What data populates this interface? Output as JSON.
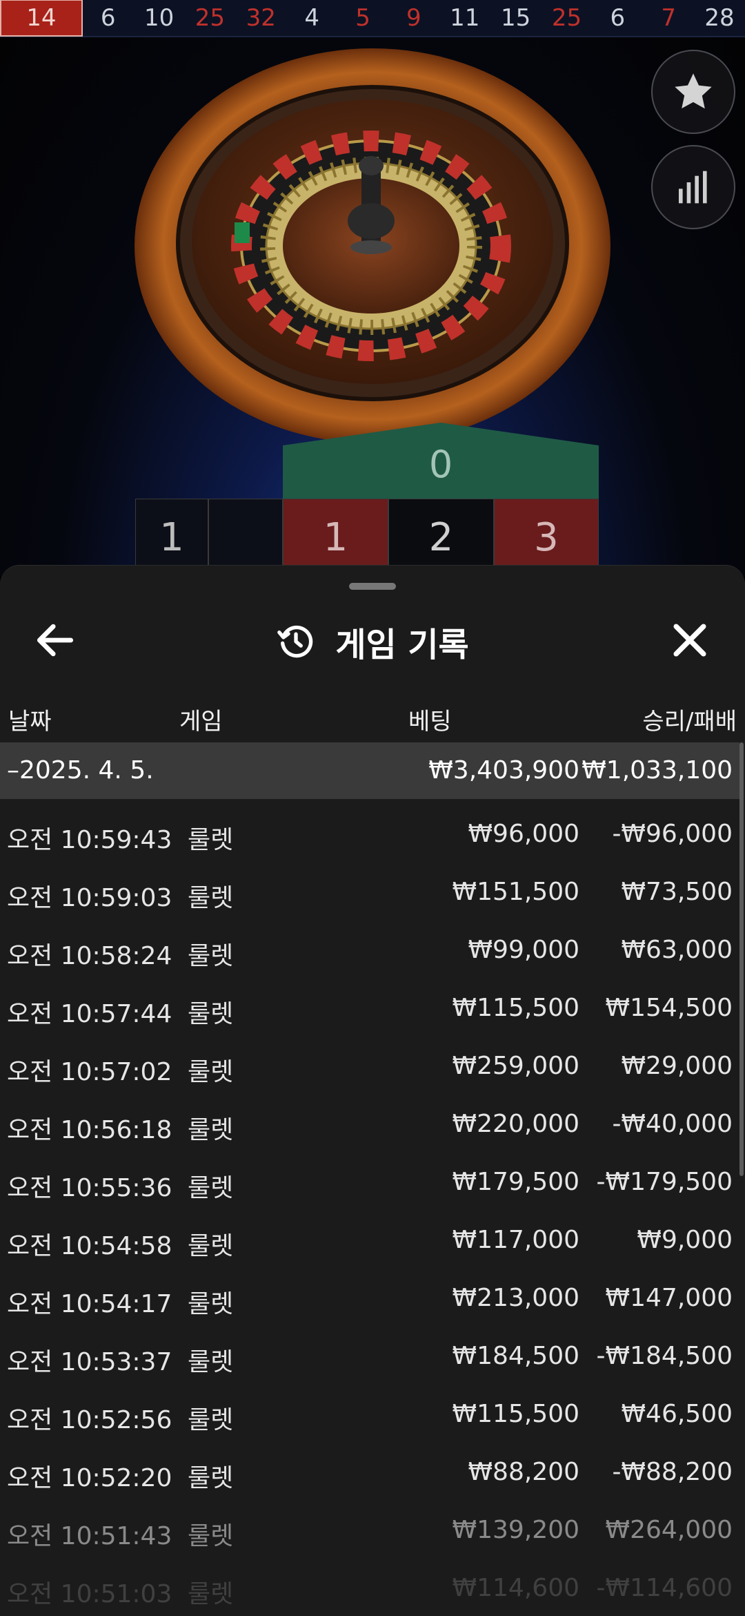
{
  "history": [
    {
      "value": "14",
      "color": "red"
    },
    {
      "value": "6",
      "color": "black"
    },
    {
      "value": "10",
      "color": "black"
    },
    {
      "value": "25",
      "color": "red"
    },
    {
      "value": "32",
      "color": "red"
    },
    {
      "value": "4",
      "color": "black"
    },
    {
      "value": "5",
      "color": "red"
    },
    {
      "value": "9",
      "color": "red"
    },
    {
      "value": "11",
      "color": "black"
    },
    {
      "value": "15",
      "color": "black"
    },
    {
      "value": "25",
      "color": "red"
    },
    {
      "value": "6",
      "color": "black"
    },
    {
      "value": "7",
      "color": "red"
    },
    {
      "value": "28",
      "color": "black"
    }
  ],
  "table": {
    "zero": "0",
    "left_cells": [
      "1",
      ""
    ],
    "cells": [
      "1",
      "2",
      "3"
    ]
  },
  "sheet": {
    "title": "게임 기록",
    "back_icon": "back-arrow-icon",
    "history_icon": "history-clock-icon",
    "close_icon": "close-icon"
  },
  "columns": {
    "date": "날짜",
    "game": "게임",
    "bet": "베팅",
    "win_loss": "승리/패배"
  },
  "summary": {
    "date": "–2025. 4. 5.",
    "bet": "₩3,403,900",
    "win_loss": "₩1,033,100"
  },
  "rows": [
    {
      "time": "오전 10:59:43",
      "game": "룰렛",
      "bet": "₩96,000",
      "win_loss": "-₩96,000"
    },
    {
      "time": "오전 10:59:03",
      "game": "룰렛",
      "bet": "₩151,500",
      "win_loss": "₩73,500"
    },
    {
      "time": "오전 10:58:24",
      "game": "룰렛",
      "bet": "₩99,000",
      "win_loss": "₩63,000"
    },
    {
      "time": "오전 10:57:44",
      "game": "룰렛",
      "bet": "₩115,500",
      "win_loss": "₩154,500"
    },
    {
      "time": "오전 10:57:02",
      "game": "룰렛",
      "bet": "₩259,000",
      "win_loss": "₩29,000"
    },
    {
      "time": "오전 10:56:18",
      "game": "룰렛",
      "bet": "₩220,000",
      "win_loss": "-₩40,000"
    },
    {
      "time": "오전 10:55:36",
      "game": "룰렛",
      "bet": "₩179,500",
      "win_loss": "-₩179,500"
    },
    {
      "time": "오전 10:54:58",
      "game": "룰렛",
      "bet": "₩117,000",
      "win_loss": "₩9,000"
    },
    {
      "time": "오전 10:54:17",
      "game": "룰렛",
      "bet": "₩213,000",
      "win_loss": "₩147,000"
    },
    {
      "time": "오전 10:53:37",
      "game": "룰렛",
      "bet": "₩184,500",
      "win_loss": "-₩184,500"
    },
    {
      "time": "오전 10:52:56",
      "game": "룰렛",
      "bet": "₩115,500",
      "win_loss": "₩46,500"
    },
    {
      "time": "오전 10:52:20",
      "game": "룰렛",
      "bet": "₩88,200",
      "win_loss": "-₩88,200"
    },
    {
      "time": "오전 10:51:43",
      "game": "룰렛",
      "bet": "₩139,200",
      "win_loss": "₩264,000"
    },
    {
      "time": "오전 10:51:03",
      "game": "룰렛",
      "bet": "₩114,600",
      "win_loss": "-₩114,600"
    }
  ],
  "colors": {
    "red": "#c0312b",
    "zero_green": "#1f5a45",
    "sheet_bg": "#1b1b1b",
    "summary_bg": "#3a3a3a"
  }
}
